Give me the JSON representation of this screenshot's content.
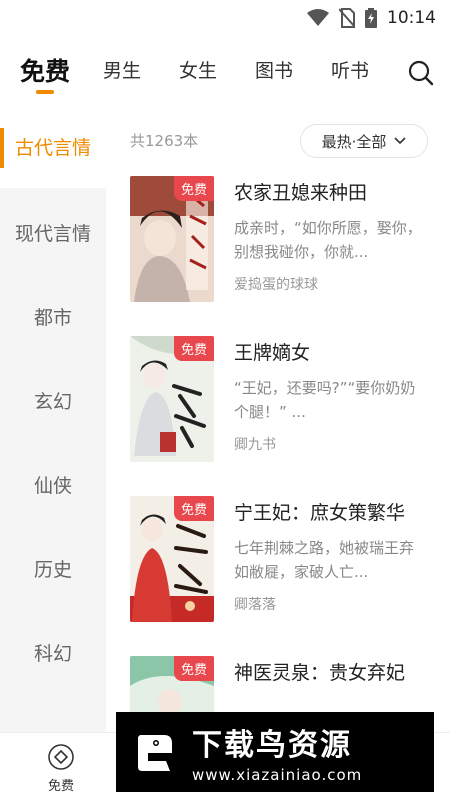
{
  "status_bar": {
    "time": "10:14",
    "icons": [
      "wifi-icon",
      "no-sim-icon",
      "battery-charging-icon"
    ]
  },
  "top_tabs": [
    {
      "label": "免费",
      "active": true
    },
    {
      "label": "男生",
      "active": false
    },
    {
      "label": "女生",
      "active": false
    },
    {
      "label": "图书",
      "active": false
    },
    {
      "label": "听书",
      "active": false
    }
  ],
  "search_icon": "search-icon",
  "sidebar": {
    "items": [
      {
        "label": "古代言情",
        "active": true
      },
      {
        "label": "现代言情",
        "active": false
      },
      {
        "label": "都市",
        "active": false
      },
      {
        "label": "玄幻",
        "active": false
      },
      {
        "label": "仙侠",
        "active": false
      },
      {
        "label": "历史",
        "active": false
      },
      {
        "label": "科幻",
        "active": false
      }
    ]
  },
  "list": {
    "count_text": "共1263本",
    "filter_label": "最热·全部",
    "free_label": "免费",
    "books": [
      {
        "title": "农家丑媳来种田",
        "desc": "成亲时，“如你所愿，娶你，别想我碰你，你就...",
        "author": "爱捣蛋的球球"
      },
      {
        "title": "王牌嫡女",
        "desc": "“王妃，还要吗?”“要你奶奶个腿！” ...",
        "author": "卿九书"
      },
      {
        "title": "宁王妃：庶女策繁华",
        "desc": "七年荆棘之路，她被瑞王弃如敝屣，家破人亡...",
        "author": "卿落落"
      },
      {
        "title": "神医灵泉：贵女弃妃",
        "desc": "",
        "author": ""
      }
    ]
  },
  "bottom_nav": {
    "items": [
      {
        "label": "免费",
        "icon": "free-diamond-icon"
      }
    ]
  },
  "watermark": {
    "main": "下载鸟资源",
    "sub": "www.xiazainiao.com"
  },
  "colors": {
    "accent": "#f08a00",
    "badge": "#e8484d",
    "sidebar_bg": "#f5f5f5"
  }
}
